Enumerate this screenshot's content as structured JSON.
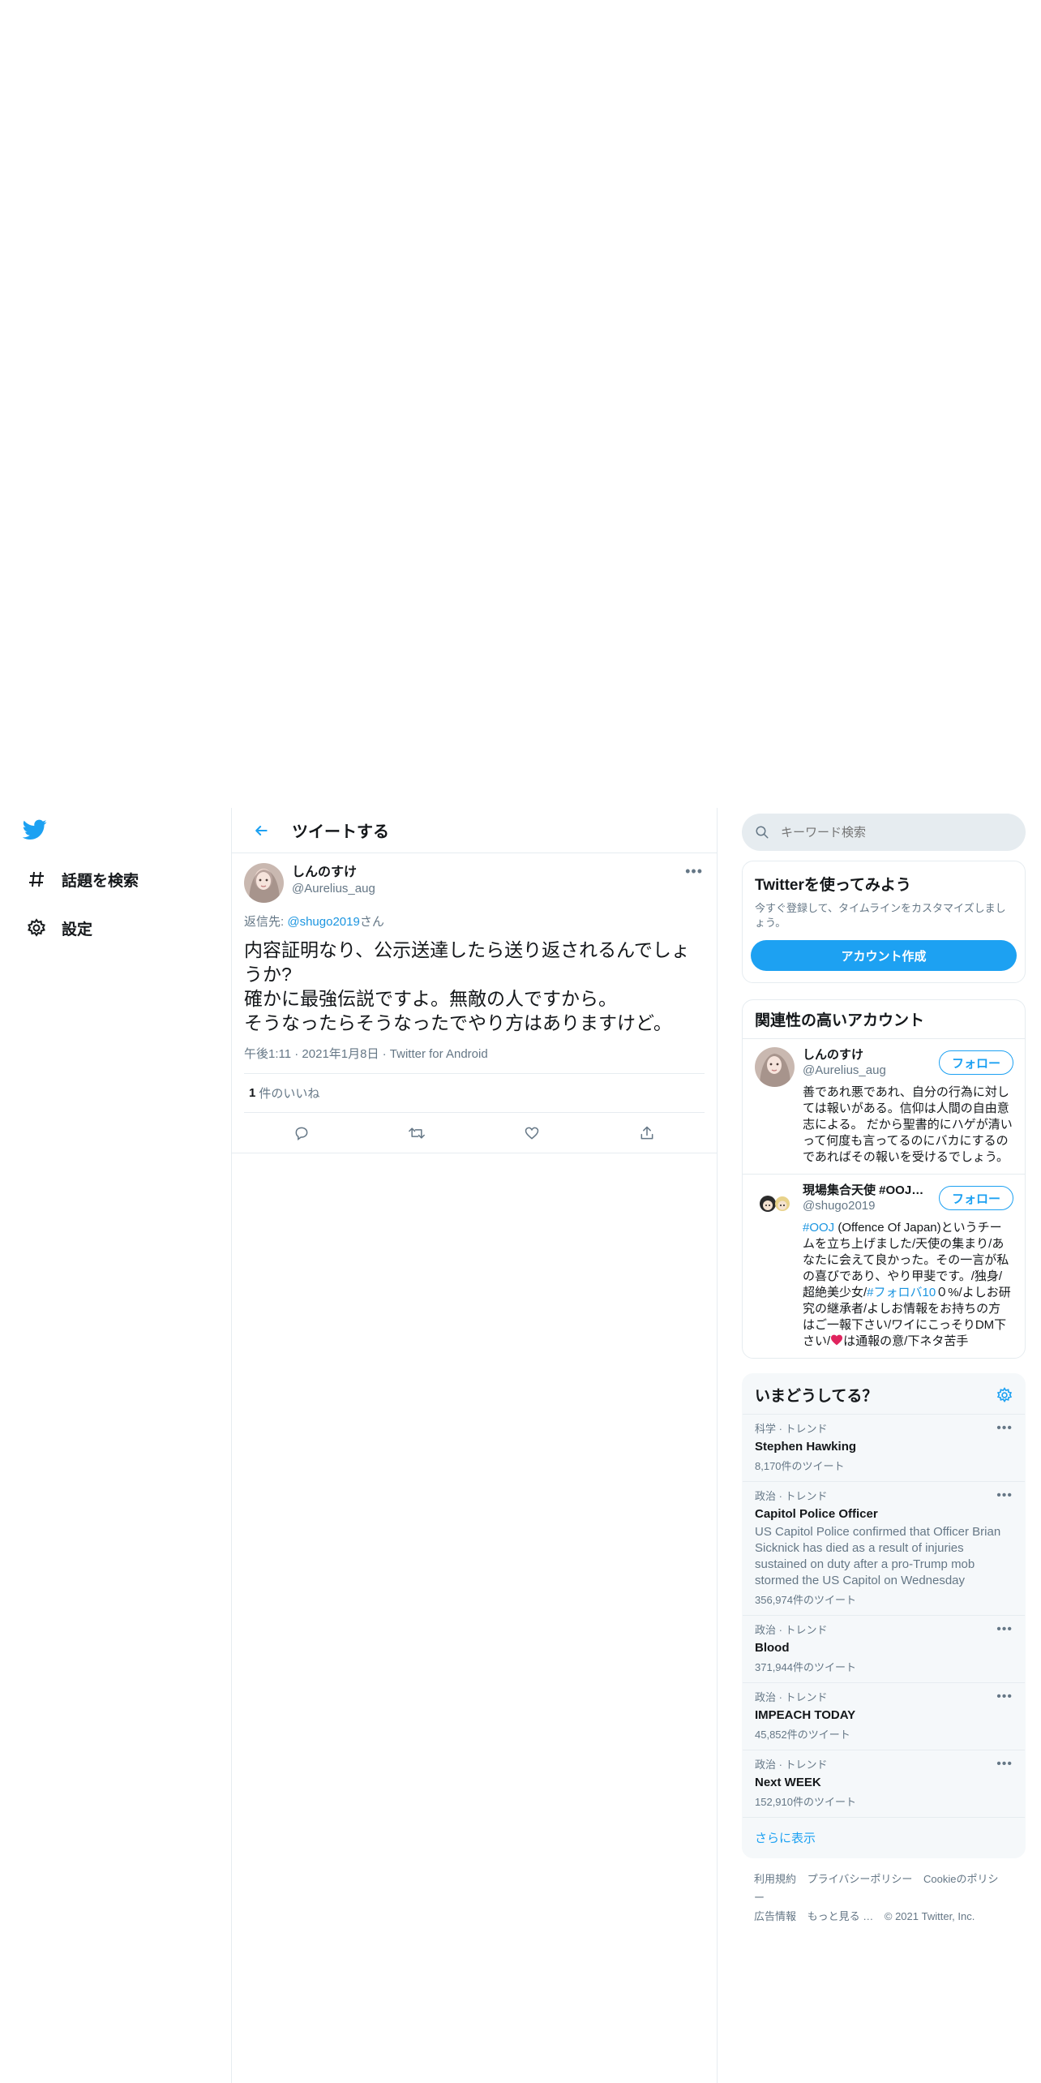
{
  "nav": {
    "explore_label": "話題を検索",
    "settings_label": "設定"
  },
  "header": {
    "title": "ツイートする"
  },
  "tweet": {
    "author_name": "しんのすけ",
    "author_handle": "@Aurelius_aug",
    "reply_prefix": "返信先: ",
    "reply_handle": "@shugo2019",
    "reply_suffix": "さん",
    "text_lines": [
      "内容証明なり、公示送達したら送り返されるんでしょ",
      "うか?",
      "確かに最強伝説ですよ。無敵の人ですから。",
      "そうなったらそうなったでやり方はありますけど。"
    ],
    "timestamp": "午後1:11 · 2021年1月8日 · Twitter for Android",
    "likes_count": "1",
    "likes_label": "件のいいね"
  },
  "search": {
    "placeholder": "キーワード検索"
  },
  "signup": {
    "title": "Twitterを使ってみよう",
    "desc": "今すぐ登録して、タイムラインをカスタマイズしましょう。",
    "button": "アカウント作成"
  },
  "related": {
    "title": "関連性の高いアカウント",
    "follow_label": "フォロー",
    "accounts": [
      {
        "name": "しんのすけ",
        "handle": "@Aurelius_aug",
        "bio": "善であれ悪であれ、自分の行為に対しては報いがある。信仰は人間の自由意志による。 だから聖書的にハゲが清いって何度も言ってるのにバカにするのであればその報いを受けるでしょう。"
      },
      {
        "name": "現場集合天使 #OOJ …",
        "handle": "@shugo2019",
        "bio_hashtag1": "#OOJ",
        "bio_part1": " (Offence Of Japan)というチームを立ち上げました/天使の集まり/あなたに会えて良かった。その一言が私の喜びであり、やり甲斐です。/独身/超絶美少女/",
        "bio_hashtag2": "#フォロバ10",
        "bio_part2": "０%/よしお研究の継承者/よしお情報をお持ちの方はご一報下さい/ワイにこっそりDM下さい/",
        "bio_part3": "は通報の意/下ネタ苦手"
      }
    ]
  },
  "trends": {
    "title": "いまどうしてる？",
    "items": [
      {
        "category": "科学 · トレンド",
        "name": "Stephen Hawking",
        "desc": "",
        "count": "8,170件のツイート"
      },
      {
        "category": "政治 · トレンド",
        "name": "Capitol Police Officer",
        "desc": "US Capitol Police confirmed that Officer Brian Sicknick has died as a result of injuries sustained on duty after a pro-Trump mob stormed the US Capitol on Wednesday",
        "count": "356,974件のツイート"
      },
      {
        "category": "政治 · トレンド",
        "name": "Blood",
        "desc": "",
        "count": "371,944件のツイート"
      },
      {
        "category": "政治 · トレンド",
        "name": "IMPEACH TODAY",
        "desc": "",
        "count": "45,852件のツイート"
      },
      {
        "category": "政治 · トレンド",
        "name": "Next WEEK",
        "desc": "",
        "count": "152,910件のツイート"
      }
    ],
    "show_more": "さらに表示"
  },
  "footer": {
    "links": [
      "利用規約",
      "プライバシーポリシー",
      "Cookieのポリシー",
      "広告情報",
      "もっと見る …",
      "© 2021 Twitter, Inc."
    ]
  },
  "colors": {
    "accent": "#1da1f2",
    "text_secondary": "#657786",
    "border": "#e6ecf0",
    "heart": "#e0245e"
  }
}
